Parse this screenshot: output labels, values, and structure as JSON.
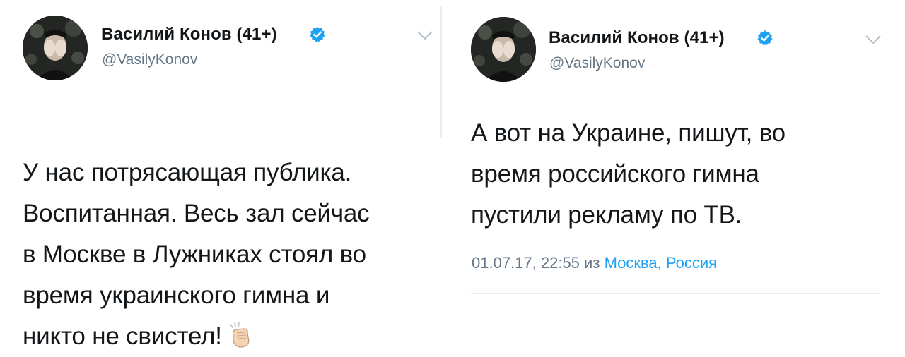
{
  "tweets": [
    {
      "author_name": "Василий Конов (41+)",
      "handle": "@VasilyKonov",
      "verified_icon": "verified-badge-icon",
      "menu_icon": "chevron-down-icon",
      "text": "У нас потрясающая публика.\nВоспитанная. Весь зал сейчас\nв Москве в Лужниках стоял во\nвремя украинского гимна и\nникто не свистел!",
      "emoji_icon": "clapping-hands-icon"
    },
    {
      "author_name": "Василий Конов (41+)",
      "handle": "@VasilyKonov",
      "verified_icon": "verified-badge-icon",
      "menu_icon": "chevron-down-icon",
      "text": "А вот на Украине, пишут, во\nвремя российского гимна\nпустили рекламу по ТВ.",
      "timestamp": "01.07.17, 22:55",
      "from_word": "из",
      "location": "Москва, Россия"
    }
  ],
  "colors": {
    "text": "#14171a",
    "secondary": "#657786",
    "link": "#1da1f2",
    "verified": "#1da1f2"
  }
}
